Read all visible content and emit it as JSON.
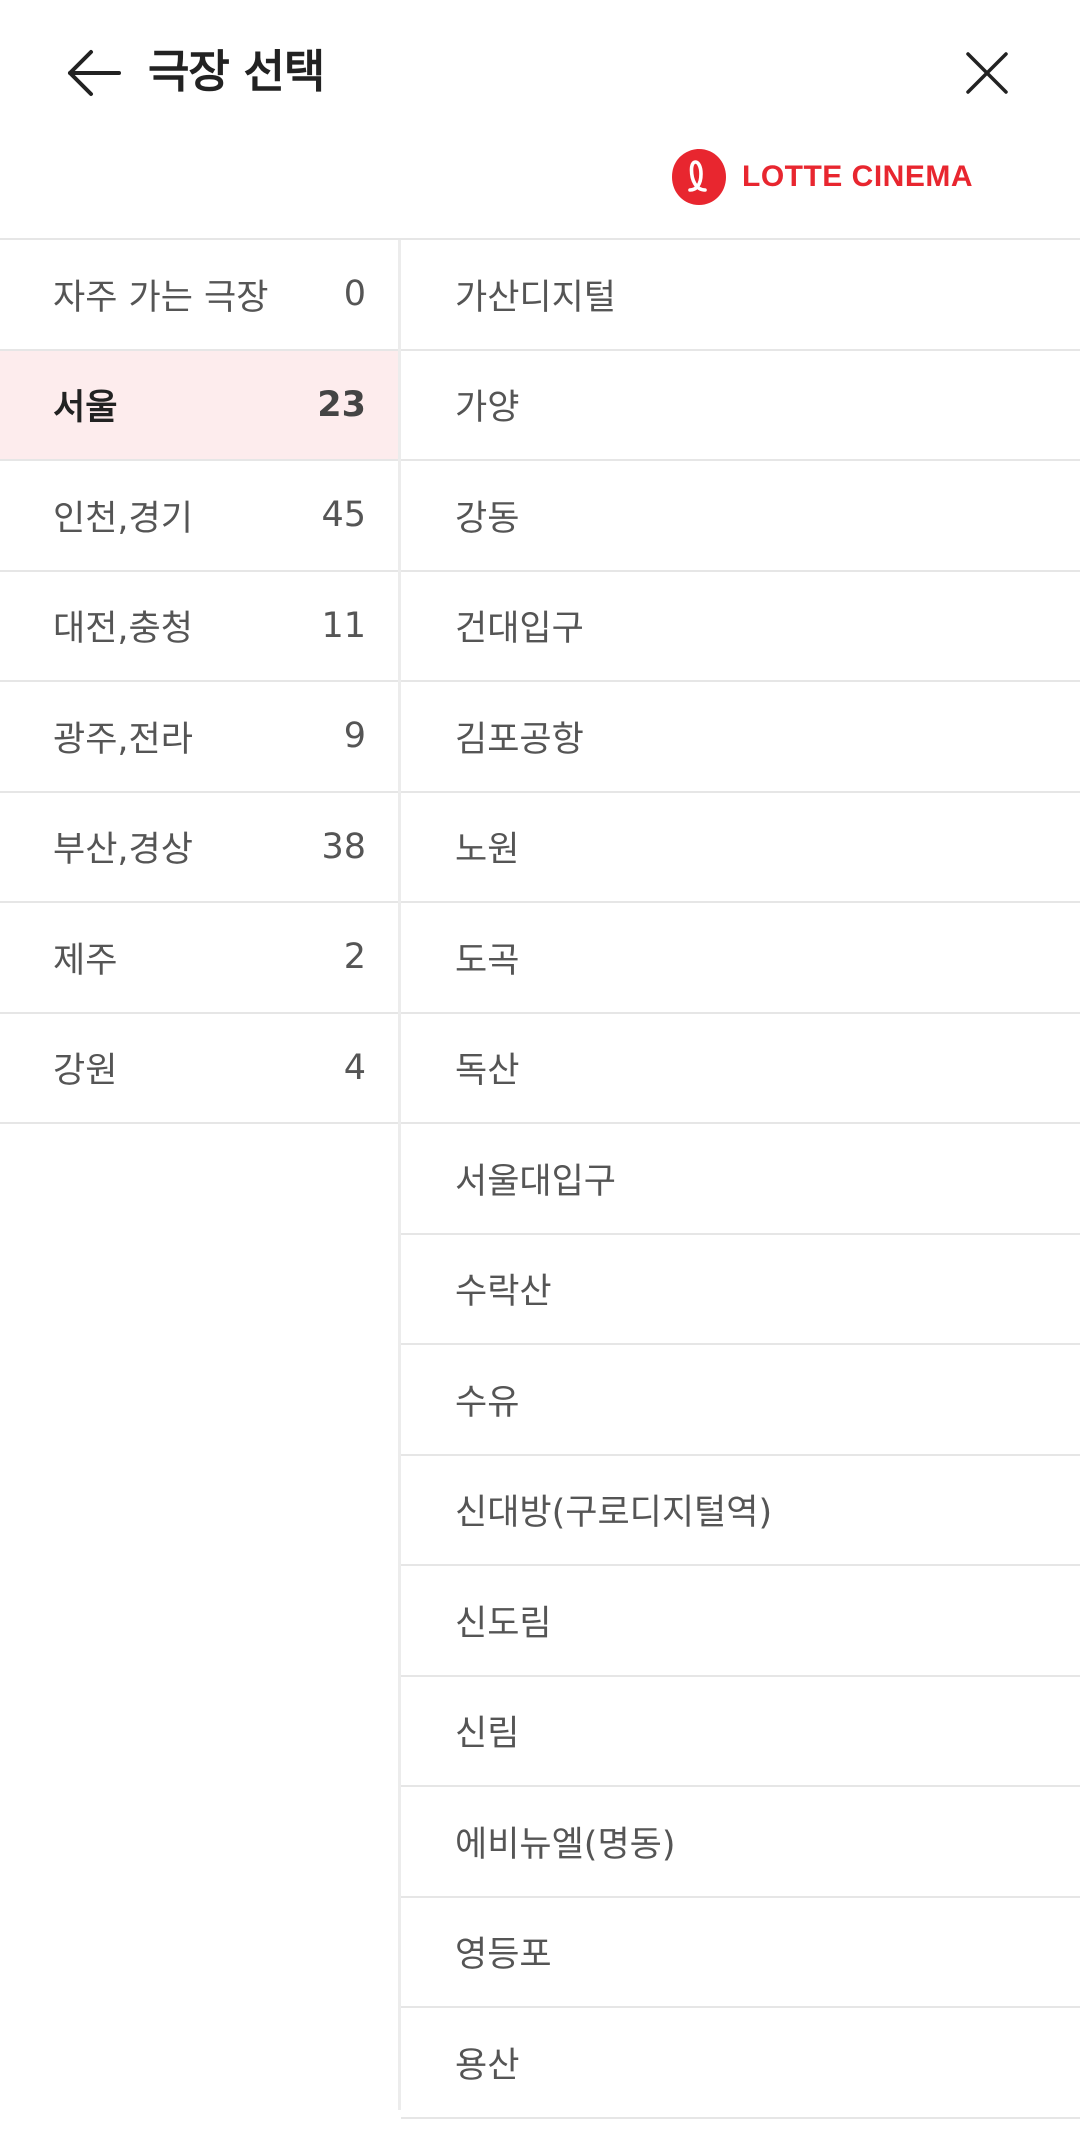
{
  "header": {
    "title": "극장 선택",
    "back_icon": "arrow-left-icon",
    "close_icon": "close-icon"
  },
  "brand": {
    "logo_text": "LOTTE CINEMA",
    "accent_color": "#e8262f",
    "selected_bg": "#fdeced"
  },
  "regions": [
    {
      "name": "자주 가는 극장",
      "count": "0",
      "selected": false
    },
    {
      "name": "서울",
      "count": "23",
      "selected": true
    },
    {
      "name": "인천,경기",
      "count": "45",
      "selected": false
    },
    {
      "name": "대전,충청",
      "count": "11",
      "selected": false
    },
    {
      "name": "광주,전라",
      "count": "9",
      "selected": false
    },
    {
      "name": "부산,경상",
      "count": "38",
      "selected": false
    },
    {
      "name": "제주",
      "count": "2",
      "selected": false
    },
    {
      "name": "강원",
      "count": "4",
      "selected": false
    }
  ],
  "theaters": [
    "가산디지털",
    "가양",
    "강동",
    "건대입구",
    "김포공항",
    "노원",
    "도곡",
    "독산",
    "서울대입구",
    "수락산",
    "수유",
    "신대방(구로디지털역)",
    "신도림",
    "신림",
    "에비뉴엘(명동)",
    "영등포",
    "용산"
  ]
}
